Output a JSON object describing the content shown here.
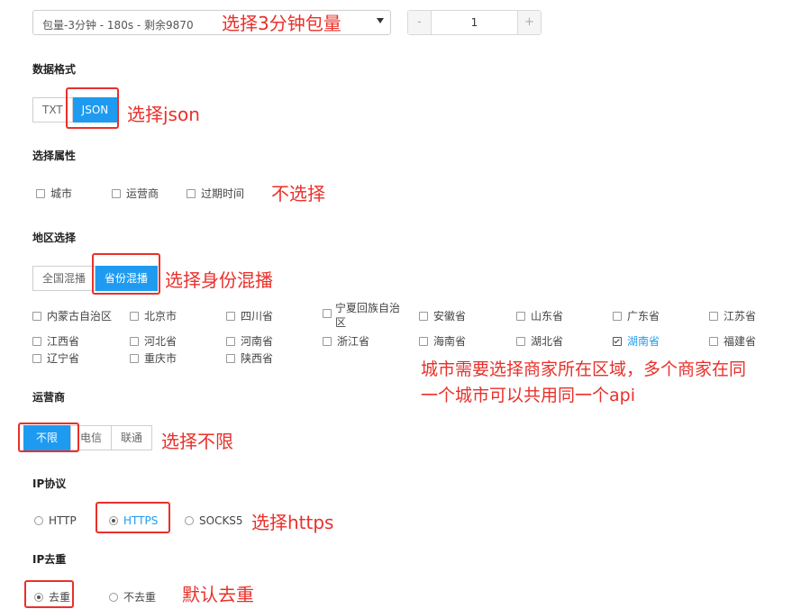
{
  "package_select": {
    "value": "包量-3分钟 - 180s - 剩余9870"
  },
  "quantity": {
    "minus": "-",
    "value": "1",
    "plus": "+"
  },
  "notes": {
    "package": "选择3分钟包量",
    "format": "选择json",
    "attributes": "不选择",
    "region": "选择身份混播",
    "city_line1": "城市需要选择商家所在区域，多个商家在同",
    "city_line2": "一个城市可以共用同一个api",
    "operator": "选择不限",
    "protocol": "选择https",
    "dedupe": "默认去重"
  },
  "data_format": {
    "heading": "数据格式",
    "options": [
      "TXT",
      "JSON"
    ],
    "selected": "JSON"
  },
  "attributes": {
    "heading": "选择属性",
    "options": [
      "城市",
      "运营商",
      "过期时间"
    ]
  },
  "region": {
    "heading": "地区选择",
    "modes": [
      "全国混播",
      "省份混播"
    ],
    "selected_mode": "省份混播",
    "provinces": [
      "内蒙古自治区",
      "北京市",
      "四川省",
      "宁夏回族自治区",
      "安徽省",
      "山东省",
      "广东省",
      "江苏省",
      "江西省",
      "河北省",
      "河南省",
      "浙江省",
      "海南省",
      "湖北省",
      "湖南省",
      "福建省",
      "辽宁省",
      "重庆市",
      "陕西省"
    ],
    "checked": "湖南省"
  },
  "operator": {
    "heading": "运营商",
    "options": [
      "不限",
      "电信",
      "联通"
    ],
    "selected": "不限"
  },
  "protocol": {
    "heading": "IP协议",
    "options": [
      "HTTP",
      "HTTPS",
      "SOCKS5"
    ],
    "selected": "HTTPS"
  },
  "dedupe": {
    "heading": "IP去重",
    "options": [
      "去重",
      "不去重"
    ],
    "selected": "去重"
  },
  "colors": {
    "accent": "#1e9bf0",
    "annotation": "#e9302a"
  }
}
